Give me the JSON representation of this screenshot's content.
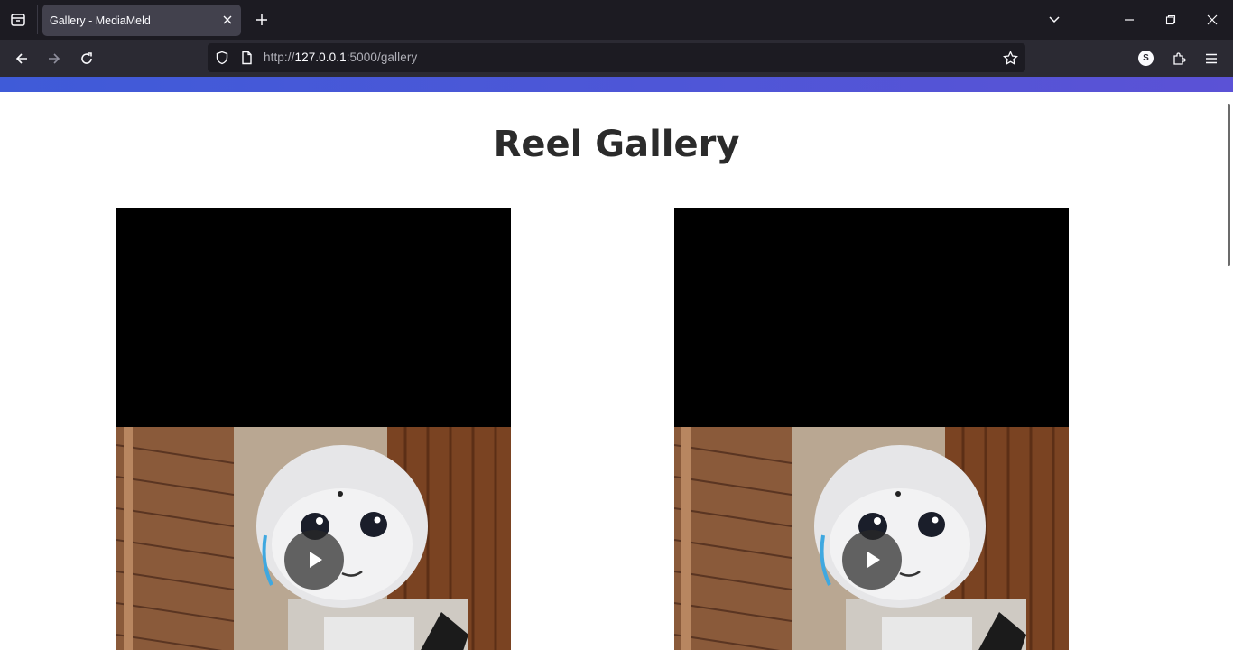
{
  "browser": {
    "tab": {
      "title": "Gallery - MediaMeld"
    },
    "url": {
      "scheme": "http://",
      "host": "127.0.0.1",
      "rest": ":5000/gallery"
    },
    "profile_initial": "S"
  },
  "page": {
    "title": "Reel Gallery",
    "colors": {
      "header_gradient_start": "#3f5bd8",
      "header_gradient_end": "#5b52d6",
      "title": "#2b2b2b"
    },
    "reels": [
      {
        "thumbnail": "robot-image",
        "action_icon": "play-icon"
      },
      {
        "thumbnail": "robot-image",
        "action_icon": "play-icon"
      }
    ]
  }
}
